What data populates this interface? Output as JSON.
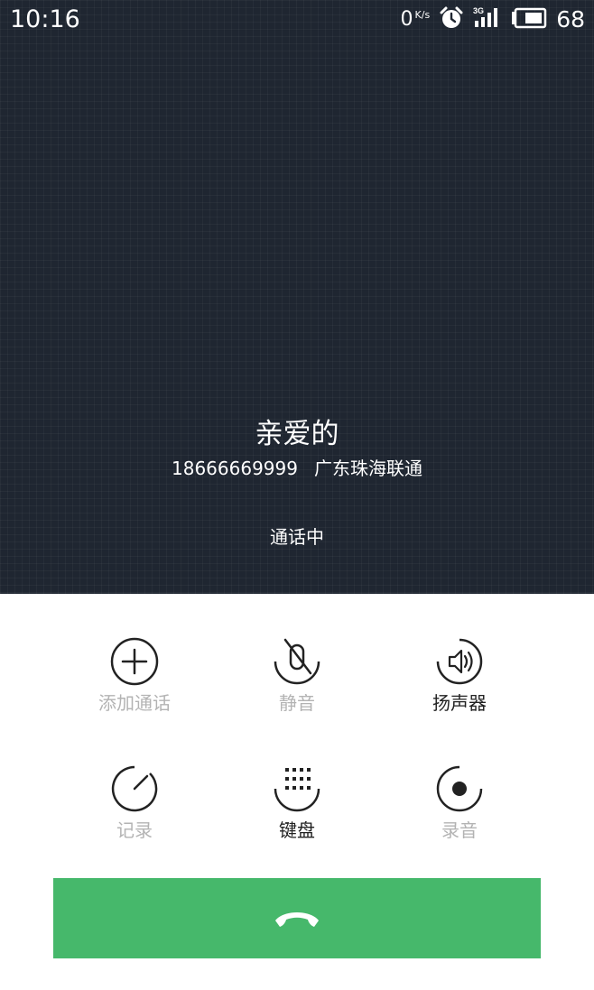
{
  "status_bar": {
    "time": "10:16",
    "net_speed_value": "0",
    "net_speed_unit": "K/s",
    "network_type": "3G",
    "battery_percent": "68",
    "icons": [
      "alarm-icon",
      "signal-3g-icon",
      "battery-icon"
    ]
  },
  "call": {
    "contact_name": "亲爱的",
    "phone_number": "18666669999",
    "location_carrier": "广东珠海联通",
    "state": "通话中"
  },
  "controls": [
    {
      "label": "添加通话",
      "icon": "add-call-icon",
      "active": false
    },
    {
      "label": "静音",
      "icon": "mute-icon",
      "active": false
    },
    {
      "label": "扬声器",
      "icon": "speaker-icon",
      "active": true
    },
    {
      "label": "记录",
      "icon": "notes-icon",
      "active": false
    },
    {
      "label": "键盘",
      "icon": "dialpad-icon",
      "active": true
    },
    {
      "label": "录音",
      "icon": "record-icon",
      "active": false
    }
  ],
  "hangup": {
    "icon": "hangup-phone-icon",
    "color": "#46b86b"
  },
  "colors": {
    "background_dark": "#1f2631",
    "active_icon": "#222222",
    "inactive_label": "#b3b3b3"
  }
}
